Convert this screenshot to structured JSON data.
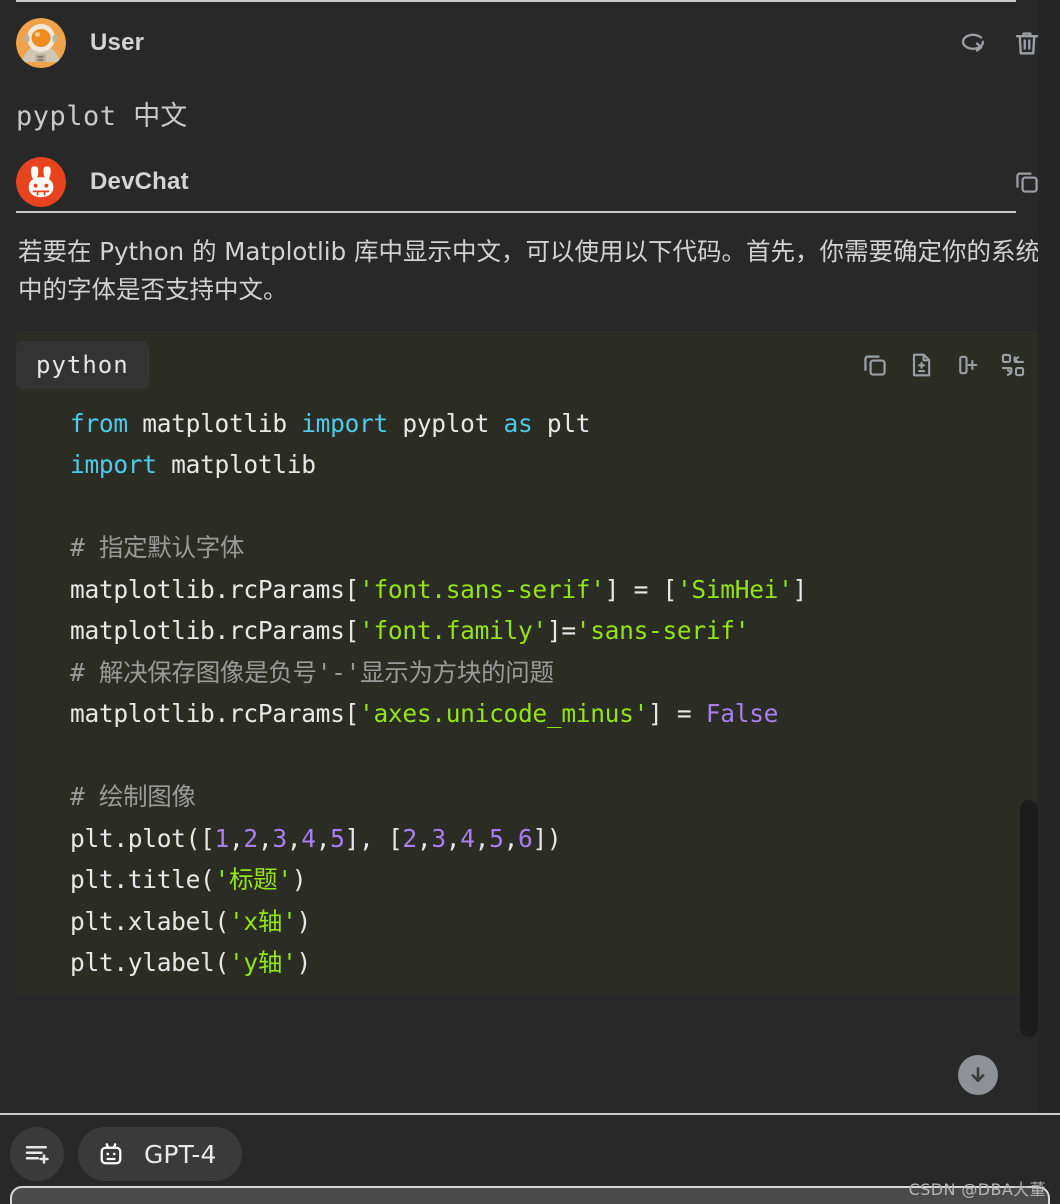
{
  "window": {
    "background": "#282828",
    "code_background": "#2b2d25",
    "accent": "#e8431f"
  },
  "messages": [
    {
      "speaker": "User",
      "avatar_icon": "astronaut-avatar",
      "actions": [
        {
          "icon": "regenerate-icon",
          "label": "Regenerate"
        },
        {
          "icon": "trash-icon",
          "label": "Delete"
        }
      ],
      "body_code": "pyplot ",
      "body_cjk": "中文"
    },
    {
      "speaker": "DevChat",
      "avatar_icon": "devchat-bunny-logo",
      "actions": [
        {
          "icon": "copy-icon",
          "label": "Copy"
        }
      ],
      "prose": "若要在 Python 的 Matplotlib 库中显示中文，可以使用以下代码。首先，你需要确定你的系统中的字体是否支持中文。"
    }
  ],
  "code_block": {
    "language_label": "python",
    "toolbar": [
      {
        "icon": "copy-icon",
        "label": "Copy code"
      },
      {
        "icon": "file-diff-icon",
        "label": "View diff"
      },
      {
        "icon": "insert-icon",
        "label": "Insert code"
      },
      {
        "icon": "replace-icon",
        "label": "Replace code"
      }
    ],
    "lines": [
      [
        {
          "t": "from",
          "c": "kw"
        },
        {
          "t": " matplotlib ",
          "c": "plain"
        },
        {
          "t": "import",
          "c": "kw"
        },
        {
          "t": " pyplot ",
          "c": "plain"
        },
        {
          "t": "as",
          "c": "kw"
        },
        {
          "t": " plt",
          "c": "plain"
        }
      ],
      [
        {
          "t": "import",
          "c": "kw"
        },
        {
          "t": " matplotlib",
          "c": "plain"
        }
      ],
      [],
      [
        {
          "t": "# ",
          "c": "cmt"
        },
        {
          "t": "指定默认字体",
          "c": "cmt cjk"
        }
      ],
      [
        {
          "t": "matplotlib.rcParams[",
          "c": "plain"
        },
        {
          "t": "'font.sans-serif'",
          "c": "str"
        },
        {
          "t": "] = [",
          "c": "plain"
        },
        {
          "t": "'SimHei'",
          "c": "str"
        },
        {
          "t": "]",
          "c": "plain"
        }
      ],
      [
        {
          "t": "matplotlib.rcParams[",
          "c": "plain"
        },
        {
          "t": "'font.family'",
          "c": "str"
        },
        {
          "t": "]=",
          "c": "plain"
        },
        {
          "t": "'sans-serif'",
          "c": "str"
        }
      ],
      [
        {
          "t": "# ",
          "c": "cmt"
        },
        {
          "t": "解决保存图像是负号",
          "c": "cmt cjk"
        },
        {
          "t": "'-'",
          "c": "cmt"
        },
        {
          "t": "显示为方块的问题",
          "c": "cmt cjk"
        }
      ],
      [
        {
          "t": "matplotlib.rcParams[",
          "c": "plain"
        },
        {
          "t": "'axes.unicode_minus'",
          "c": "str"
        },
        {
          "t": "] = ",
          "c": "plain"
        },
        {
          "t": "False",
          "c": "const"
        }
      ],
      [],
      [
        {
          "t": "# ",
          "c": "cmt"
        },
        {
          "t": "绘制图像",
          "c": "cmt cjk"
        }
      ],
      [
        {
          "t": "plt.plot([",
          "c": "plain"
        },
        {
          "t": "1",
          "c": "num"
        },
        {
          "t": ",",
          "c": "plain"
        },
        {
          "t": "2",
          "c": "num"
        },
        {
          "t": ",",
          "c": "plain"
        },
        {
          "t": "3",
          "c": "num"
        },
        {
          "t": ",",
          "c": "plain"
        },
        {
          "t": "4",
          "c": "num"
        },
        {
          "t": ",",
          "c": "plain"
        },
        {
          "t": "5",
          "c": "num"
        },
        {
          "t": "], [",
          "c": "plain"
        },
        {
          "t": "2",
          "c": "num"
        },
        {
          "t": ",",
          "c": "plain"
        },
        {
          "t": "3",
          "c": "num"
        },
        {
          "t": ",",
          "c": "plain"
        },
        {
          "t": "4",
          "c": "num"
        },
        {
          "t": ",",
          "c": "plain"
        },
        {
          "t": "5",
          "c": "num"
        },
        {
          "t": ",",
          "c": "plain"
        },
        {
          "t": "6",
          "c": "num"
        },
        {
          "t": "])",
          "c": "plain"
        }
      ],
      [
        {
          "t": "plt.title(",
          "c": "plain"
        },
        {
          "t": "'",
          "c": "str"
        },
        {
          "t": "标题",
          "c": "str cjk"
        },
        {
          "t": "'",
          "c": "str"
        },
        {
          "t": ")",
          "c": "plain"
        }
      ],
      [
        {
          "t": "plt.xlabel(",
          "c": "plain"
        },
        {
          "t": "'x",
          "c": "str"
        },
        {
          "t": "轴",
          "c": "str cjk"
        },
        {
          "t": "'",
          "c": "str"
        },
        {
          "t": ")",
          "c": "plain"
        }
      ],
      [
        {
          "t": "plt.ylabel(",
          "c": "plain"
        },
        {
          "t": "'y",
          "c": "str"
        },
        {
          "t": "轴",
          "c": "str cjk"
        },
        {
          "t": "'",
          "c": "str"
        },
        {
          "t": ")",
          "c": "plain"
        }
      ]
    ]
  },
  "scroll_to_bottom": {
    "icon": "arrow-down-icon",
    "label": "Scroll to bottom"
  },
  "bottom_bar": {
    "add_context_button": {
      "icon": "add-lines-icon",
      "label": "Add context"
    },
    "model_selector": {
      "icon": "robot-icon",
      "label": "GPT-4"
    }
  },
  "watermark": "CSDN @DBA大董"
}
